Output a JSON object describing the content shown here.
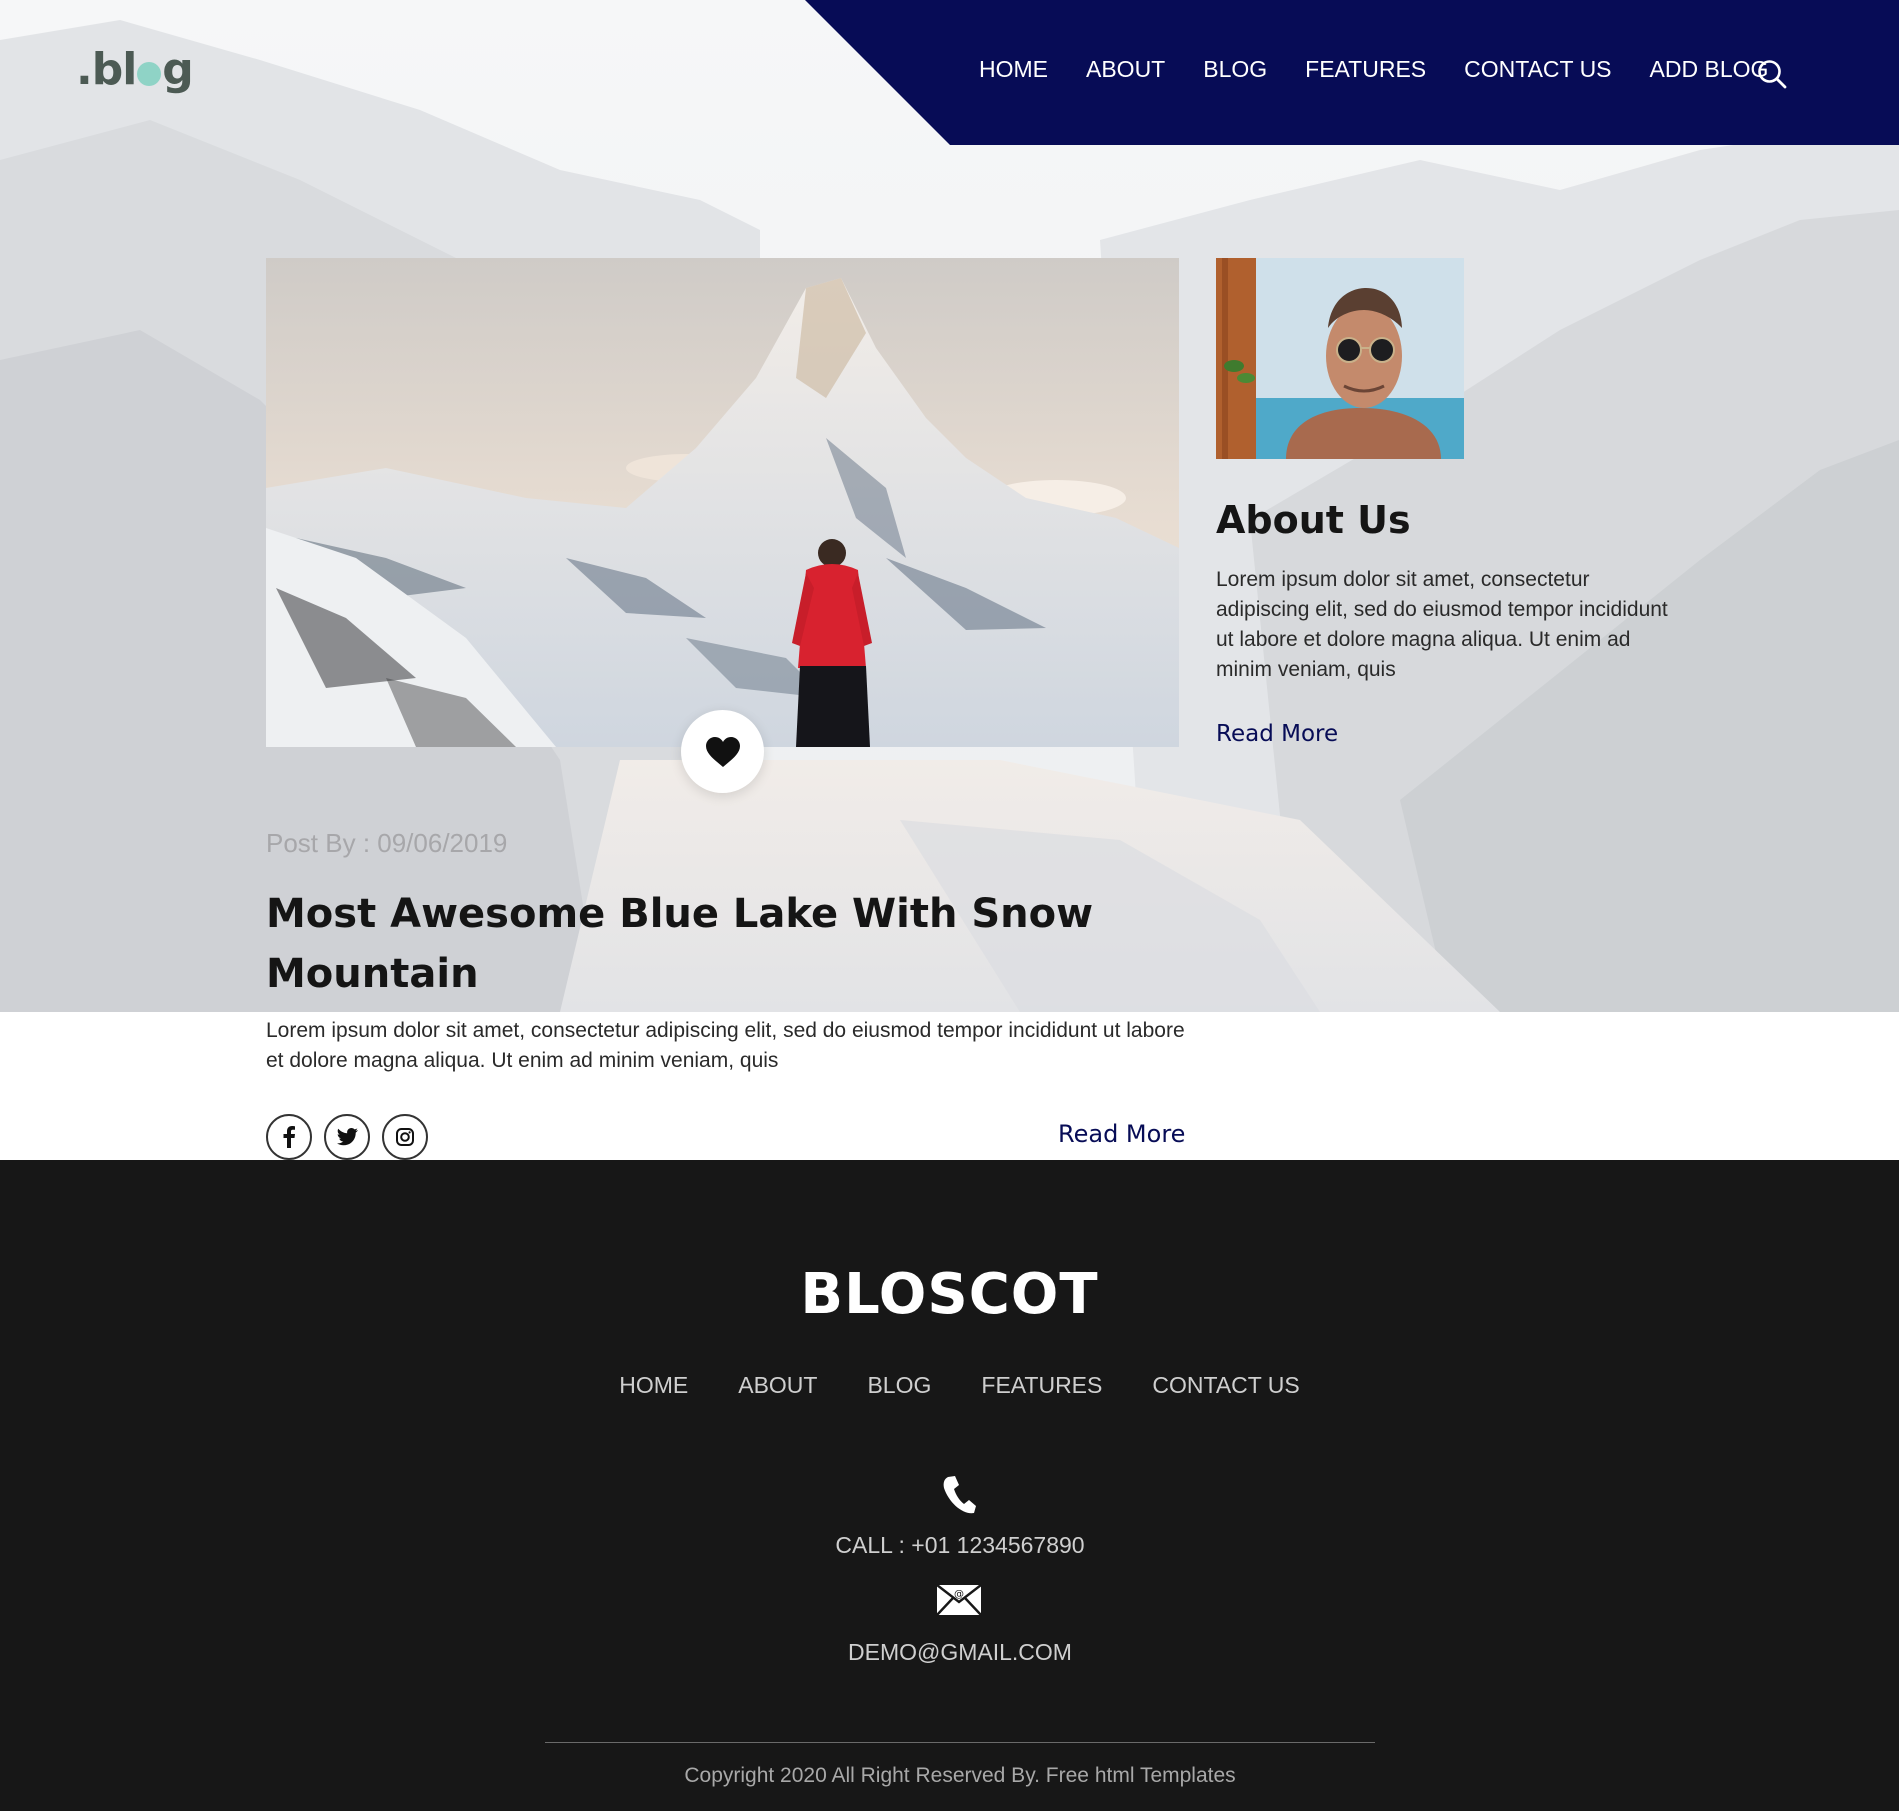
{
  "logo": {
    "prefix": ".bl",
    "suffix": "g"
  },
  "nav": {
    "items": [
      {
        "label": "HOME"
      },
      {
        "label": "ABOUT"
      },
      {
        "label": "BLOG"
      },
      {
        "label": "FEATURES"
      },
      {
        "label": "CONTACT US"
      },
      {
        "label": "ADD BLOG"
      }
    ],
    "search_icon": "search-icon"
  },
  "post": {
    "meta": "Post By : 09/06/2019",
    "title": "Most Awesome Blue Lake With Snow Mountain",
    "excerpt": "Lorem ipsum dolor sit amet, consectetur adipiscing elit, sed do eiusmod tempor incididunt ut labore et dolore magna aliqua. Ut enim ad minim veniam, quis",
    "read_more": "Read More",
    "icons": [
      "heart-icon",
      "facebook-icon",
      "twitter-icon",
      "instagram-icon"
    ]
  },
  "about": {
    "title": "About Us",
    "text": "Lorem ipsum dolor sit amet, consectetur adipiscing elit, sed do eiusmod tempor incididunt ut labore et dolore magna aliqua. Ut enim ad minim veniam, quis",
    "read_more": "Read More"
  },
  "footer": {
    "brand": "BLOSCOT",
    "links": [
      {
        "label": "HOME"
      },
      {
        "label": "ABOUT"
      },
      {
        "label": "BLOG"
      },
      {
        "label": "FEATURES"
      },
      {
        "label": "CONTACT US"
      }
    ],
    "call": "CALL : +01 1234567890",
    "email": "DEMO@GMAIL.COM",
    "copyright": "Copyright 2020 All Right Reserved By. Free html Templates",
    "icons": [
      "phone-icon",
      "mail-icon"
    ]
  },
  "colors": {
    "nav_bg": "#070c56",
    "accent": "#070c56",
    "logo_dot": "#8fd3c6",
    "footer_bg": "#171717"
  }
}
